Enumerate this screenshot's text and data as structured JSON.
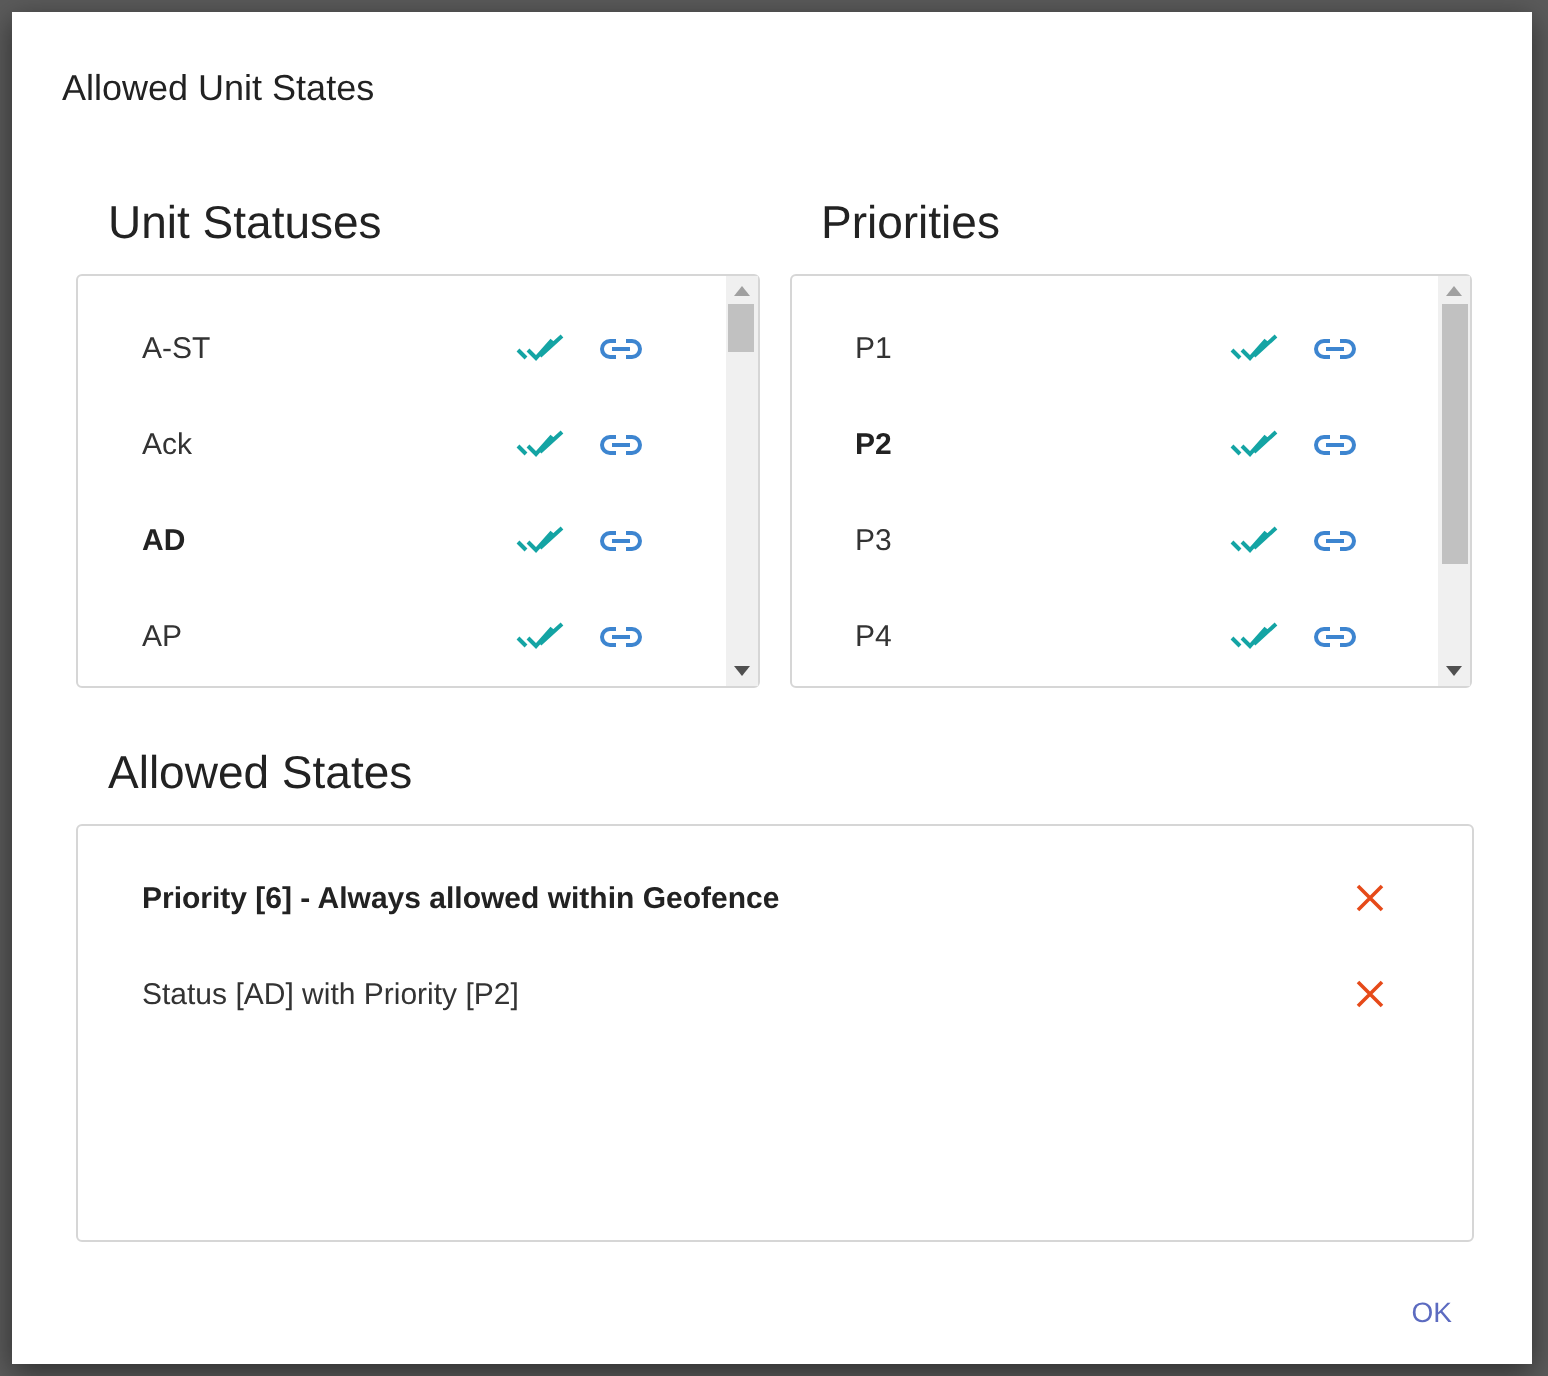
{
  "dialog": {
    "title": "Allowed Unit States",
    "unit_statuses": {
      "heading": "Unit Statuses",
      "items": [
        {
          "label": "A-ST",
          "selected": false
        },
        {
          "label": "Ack",
          "selected": false
        },
        {
          "label": "AD",
          "selected": true
        },
        {
          "label": "AP",
          "selected": false
        }
      ]
    },
    "priorities": {
      "heading": "Priorities",
      "items": [
        {
          "label": "P1",
          "selected": false
        },
        {
          "label": "P2",
          "selected": true
        },
        {
          "label": "P3",
          "selected": false
        },
        {
          "label": "P4",
          "selected": false
        }
      ]
    },
    "allowed_states": {
      "heading": "Allowed States",
      "items": [
        {
          "label": "Priority [6] - Always allowed within Geofence",
          "bold": true
        },
        {
          "label": "Status [AD] with Priority [P2]",
          "bold": false
        }
      ]
    },
    "buttons": [
      "OK"
    ]
  }
}
